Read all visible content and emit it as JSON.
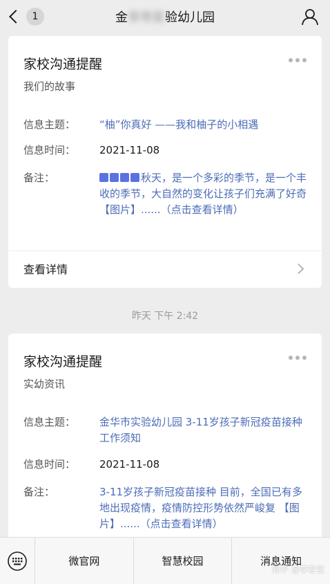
{
  "nav": {
    "back_badge": "1",
    "title_prefix": "金",
    "title_blurred": "华市实",
    "title_suffix": "验幼儿园"
  },
  "card1": {
    "title": "家校沟通提醒",
    "subtitle": "我们的故事",
    "topic_label": "信息主题：",
    "topic_value": "“柚”你真好 ——我和柚子的小相遇",
    "time_label": "信息时间：",
    "time_value": "2021-11-08",
    "note_label": "备注：",
    "note_value": "秋天，是一个多彩的季节，是一个丰收的季节，大自然的变化让孩子们充满了好奇 【图片】......（点击查看详情）",
    "detail_label": "查看详情"
  },
  "timestamp": "昨天 下午 2:42",
  "card2": {
    "title": "家校沟通提醒",
    "subtitle": "实幼资讯",
    "topic_label": "信息主题：",
    "topic_value": "金华市实验幼儿园 3-11岁孩子新冠疫苗接种工作须知",
    "time_label": "信息时间：",
    "time_value": "2021-11-08",
    "note_label": "备注：",
    "note_value": "3-11岁孩子新冠疫苗接种 目前，全国已有多地出现疫情，疫情防控形势依然严峻复 【图片】......（点击查看详情）"
  },
  "tabbar": {
    "tab1": "微官网",
    "tab2": "智慧校园",
    "tab3": "消息通知"
  },
  "watermark": "知乎 @李客宝"
}
